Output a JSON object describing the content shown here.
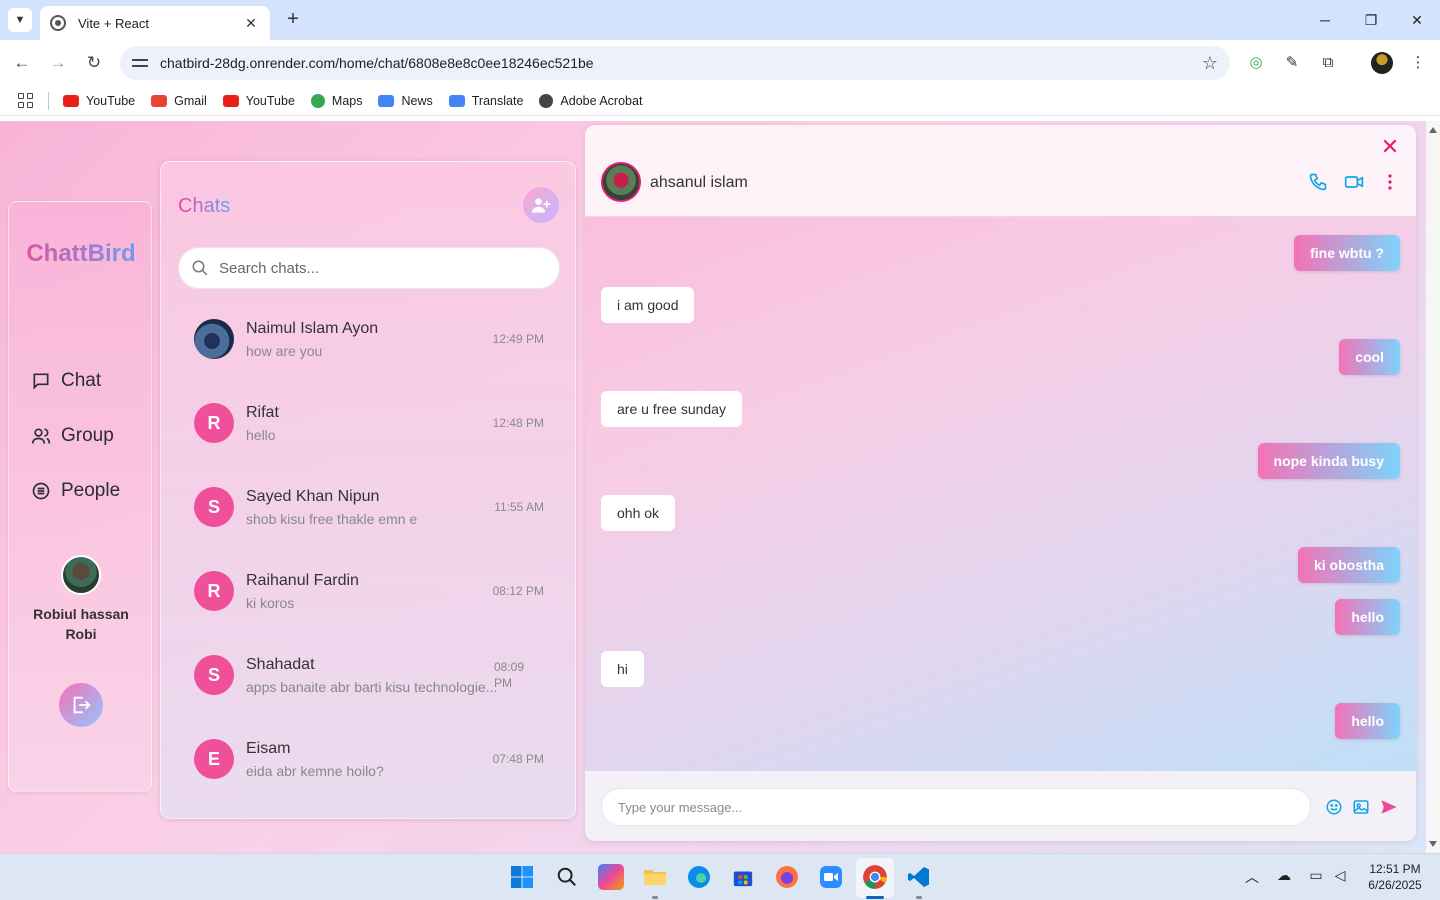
{
  "browser": {
    "tab_title": "Vite + React",
    "url": "chatbird-28dg.onrender.com/home/chat/6808e8e8c0ee18246ec521be",
    "bookmarks": [
      {
        "label": "YouTube",
        "icon": "youtube-icon",
        "color": "#e62117"
      },
      {
        "label": "Gmail",
        "icon": "gmail-icon",
        "color": "#ea4335"
      },
      {
        "label": "YouTube",
        "icon": "youtube-icon",
        "color": "#e62117"
      },
      {
        "label": "Maps",
        "icon": "maps-icon",
        "color": "#34a853"
      },
      {
        "label": "News",
        "icon": "news-icon",
        "color": "#4285f4"
      },
      {
        "label": "Translate",
        "icon": "translate-icon",
        "color": "#4285f4"
      },
      {
        "label": "Adobe Acrobat",
        "icon": "acrobat-icon",
        "color": "#444444"
      }
    ]
  },
  "sidebar": {
    "brand": "ChattBird",
    "nav": [
      {
        "label": "Chat",
        "icon": "chat-bubble-icon"
      },
      {
        "label": "Group",
        "icon": "users-icon"
      },
      {
        "label": "People",
        "icon": "list-circle-icon"
      }
    ],
    "user_name": "Robiul hassan Robi"
  },
  "chatlist": {
    "title": "Chats",
    "search_placeholder": "Search chats...",
    "conversations": [
      {
        "name": "Naimul Islam Ayon",
        "last": "how are you",
        "time": "12:49 PM",
        "initial": "",
        "photo": true
      },
      {
        "name": "Rifat",
        "last": "hello",
        "time": "12:48 PM",
        "initial": "R",
        "photo": false
      },
      {
        "name": "Sayed Khan Nipun",
        "last": "shob kisu free thakle emn e",
        "time": "11:55 AM",
        "initial": "S",
        "photo": false
      },
      {
        "name": "Raihanul Fardin",
        "last": "ki koros",
        "time": "08:12 PM",
        "initial": "R",
        "photo": false
      },
      {
        "name": "Shahadat",
        "last": "apps banaite abr barti kisu technologie...",
        "time": "08:09 PM",
        "initial": "S",
        "photo": false
      },
      {
        "name": "Eisam",
        "last": "eida abr kemne hoilo?",
        "time": "07:48 PM",
        "initial": "E",
        "photo": false
      }
    ]
  },
  "chat": {
    "contact_name": "ahsanul islam",
    "messages": [
      {
        "text": "fine wbtu ?",
        "dir": "out"
      },
      {
        "text": "i am good",
        "dir": "in"
      },
      {
        "text": "cool",
        "dir": "out"
      },
      {
        "text": "are u free sunday",
        "dir": "in"
      },
      {
        "text": "nope kinda busy",
        "dir": "out"
      },
      {
        "text": "ohh ok",
        "dir": "in"
      },
      {
        "text": "ki obostha",
        "dir": "out"
      },
      {
        "text": "hello",
        "dir": "out"
      },
      {
        "text": "hi",
        "dir": "in"
      },
      {
        "text": "hello",
        "dir": "out"
      }
    ],
    "input_placeholder": "Type your message..."
  },
  "taskbar": {
    "time": "12:51 PM",
    "date": "6/26/2025"
  },
  "colors": {
    "accent_pink": "#ec4899",
    "accent_blue": "#60a5fa",
    "avatar_pink": "#f0509a"
  }
}
